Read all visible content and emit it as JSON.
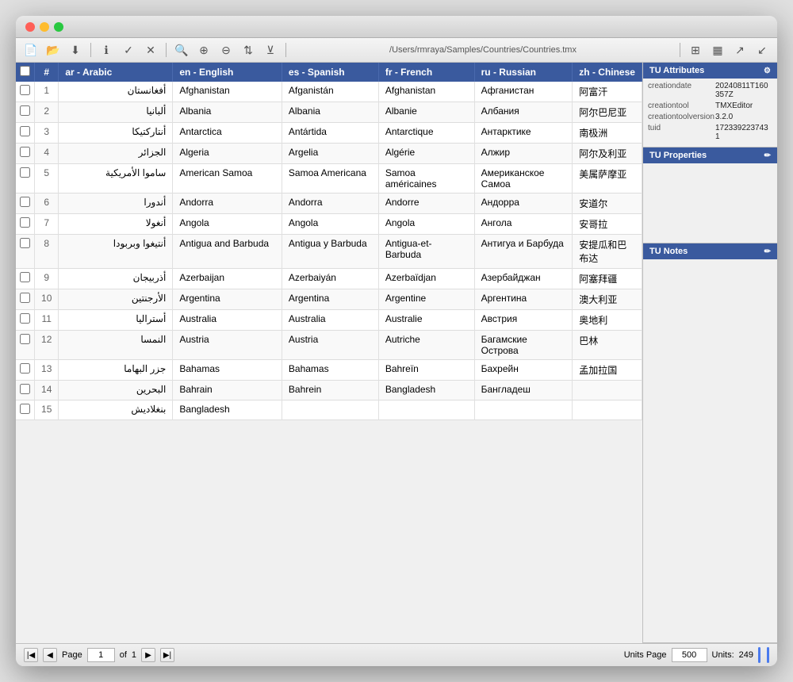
{
  "window": {
    "title": "/Users/rmraya/Samples/Countries/Countries.tmx"
  },
  "toolbar": {
    "path": "/Users/rmraya/Samples/Countries/Countries.tmx"
  },
  "table": {
    "headers": {
      "check": "",
      "num": "#",
      "ar": "ar - Arabic",
      "en": "en - English",
      "es": "es - Spanish",
      "fr": "fr - French",
      "ru": "ru - Russian",
      "zh": "zh - Chinese"
    },
    "rows": [
      {
        "num": 1,
        "ar": "أفغانستان",
        "en": "Afghanistan",
        "es": "Afganistán",
        "fr": "Afghanistan",
        "ru": "Афганистан",
        "zh": "阿富汗"
      },
      {
        "num": 2,
        "ar": "ألبانيا",
        "en": "Albania",
        "es": "Albania",
        "fr": "Albanie",
        "ru": "Албания",
        "zh": "阿尔巴尼亚"
      },
      {
        "num": 3,
        "ar": "أنتاركتيكا",
        "en": "Antarctica",
        "es": "Antártida",
        "fr": "Antarctique",
        "ru": "Антарктике",
        "zh": "南极洲"
      },
      {
        "num": 4,
        "ar": "الجزائر",
        "en": "Algeria",
        "es": "Argelia",
        "fr": "Algérie",
        "ru": "Алжир",
        "zh": "阿尔及利亚"
      },
      {
        "num": 5,
        "ar": "ساموا الأمريكية",
        "en": "American Samoa",
        "es": "Samoa Americana",
        "fr": "Samoa américaines",
        "ru": "Американское Самоа",
        "zh": "美属萨摩亚"
      },
      {
        "num": 6,
        "ar": "أندورا",
        "en": "Andorra",
        "es": "Andorra",
        "fr": "Andorre",
        "ru": "Андорра",
        "zh": "安道尔"
      },
      {
        "num": 7,
        "ar": "أنغولا",
        "en": "Angola",
        "es": "Angola",
        "fr": "Angola",
        "ru": "Ангола",
        "zh": "安哥拉"
      },
      {
        "num": 8,
        "ar": "أنتيغوا وبربودا",
        "en": "Antigua and Barbuda",
        "es": "Antigua y Barbuda",
        "fr": "Antigua-et-Barbuda",
        "ru": "Антигуа и Барбуда",
        "zh": "安提瓜和巴布达"
      },
      {
        "num": 9,
        "ar": "أذربيجان",
        "en": "Azerbaijan",
        "es": "Azerbaiyán",
        "fr": "Azerbaïdjan",
        "ru": "Азербайджан",
        "zh": "阿塞拜疆"
      },
      {
        "num": 10,
        "ar": "الأرجنتين",
        "en": "Argentina",
        "es": "Argentina",
        "fr": "Argentine",
        "ru": "Аргентина",
        "zh": "澳大利亚"
      },
      {
        "num": 11,
        "ar": "أستراليا",
        "en": "Australia",
        "es": "Australia",
        "fr": "Australie",
        "ru": "Австрия",
        "zh": "奥地利"
      },
      {
        "num": 12,
        "ar": "النمسا",
        "en": "Austria",
        "es": "Austria",
        "fr": "Autriche",
        "ru": "Багамские Острова",
        "zh": "巴林"
      },
      {
        "num": 13,
        "ar": "جزر البهاما",
        "en": "Bahamas",
        "es": "Bahamas",
        "fr": "Bahreïn",
        "ru": "Бахрейн",
        "zh": "孟加拉国"
      },
      {
        "num": 14,
        "ar": "البحرين",
        "en": "Bahrain",
        "es": "Bahrein",
        "fr": "Bangladesh",
        "ru": "Бангладеш",
        "zh": ""
      },
      {
        "num": 15,
        "ar": "بنغلاديش",
        "en": "Bangladesh",
        "es": "",
        "fr": "",
        "ru": "",
        "zh": ""
      }
    ]
  },
  "right_panel": {
    "tu_attributes": {
      "header": "TU Attributes",
      "attrs": [
        {
          "key": "creationdate",
          "value": "20240811T160357Z"
        },
        {
          "key": "creationtool",
          "value": "TMXEditor"
        },
        {
          "key": "creationtoolversion",
          "value": "3.2.0"
        },
        {
          "key": "tuid",
          "value": "1723392237431"
        }
      ]
    },
    "tu_properties": {
      "header": "TU Properties"
    },
    "tu_notes": {
      "header": "TU Notes"
    }
  },
  "bottom_bar": {
    "page_label": "Page",
    "page_value": "1",
    "of_label": "of",
    "total_pages": "1",
    "units_page_label": "Units Page",
    "units_page_value": "500",
    "units_label": "Units:",
    "units_value": "249"
  }
}
